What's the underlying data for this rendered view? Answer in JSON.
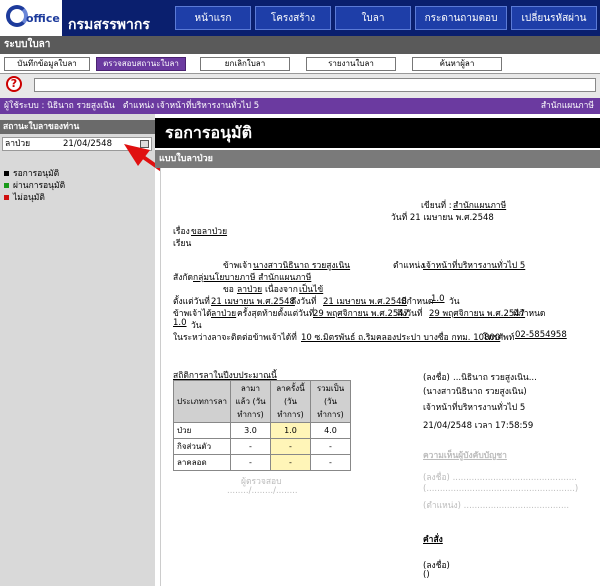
{
  "header": {
    "logo_text": "office",
    "org_name": "กรมสรรพากร",
    "nav": [
      {
        "label": "หน้าแรก"
      },
      {
        "label": "โครงสร้าง"
      },
      {
        "label": "ใบลา"
      },
      {
        "label": "กระดานถามตอบ"
      },
      {
        "label": "เปลี่ยนรหัสผ่าน"
      }
    ]
  },
  "system_title": "ระบบใบลา",
  "menu": [
    {
      "label": "บันทึกข้อมูลใบลา"
    },
    {
      "label": "ตรวจสอบสถานะใบลา"
    },
    {
      "label": "ยกเลิกใบลา"
    },
    {
      "label": "รายงานใบลา"
    },
    {
      "label": "ค้นหาผู้ลา"
    }
  ],
  "help": {
    "icon_char": "?"
  },
  "userbar": {
    "user": "ผู้ใช้ระบบ : นิธินาถ รวยสูงเนิน",
    "position": "ตำแหน่ง เจ้าหน้าที่บริหารงานทั่วไป 5",
    "dept": "สำนักแผนภาษี"
  },
  "left": {
    "title": "สถานะใบลาของท่าน",
    "row_type": "ลาป่วย",
    "row_date": "21/04/2548",
    "legend": [
      {
        "label": "รอการอนุมัติ",
        "color": "#000000"
      },
      {
        "label": "ผ่านการอนุมัติ",
        "color": "#1a9a1a"
      },
      {
        "label": "ไม่อนุมัติ",
        "color": "#d01010"
      }
    ]
  },
  "main": {
    "title": "รอการอนุมัติ",
    "form_name": "แบบใบลาป่วย",
    "written_at_label": "เขียนที่ :",
    "written_at": "สำนักแผนภาษี",
    "date_line": "วันที่ 21 เมษายน พ.ศ.2548",
    "subject_label": "เรื่อง",
    "subject": "ขอลาป่วย",
    "to": "เรียน",
    "i_am": "ข้าพเจ้า",
    "name": "นางสาวนิธินาถ รวยสูงเนิน",
    "position_label": "ตำแหน่ง",
    "position": "เจ้าหน้าที่บริหารงานทั่วไป 5",
    "affiliation_label": "สังกัด",
    "affiliation": "กลุ่มนโยบายภาษี สำนักแผนภาษี",
    "request_label": "ขอ",
    "request": "ลาป่วย",
    "reason_label": "เนื่องจาก",
    "reason": "เป็นไข้",
    "from_label": "ตั้งแต่วันที่",
    "from_date": "21 เมษายน พ.ศ.2548",
    "to_label": "ถึงวันที่",
    "to_date": "21 เมษายน พ.ศ.2548",
    "days_label": "มีกำหนด",
    "days": "1.0",
    "days_unit": "วัน",
    "last_label": "ข้าพเจ้าได้",
    "last_type": "ลาป่วย",
    "last_mid": "ครั้งสุดท้ายตั้งแต่วันที่",
    "last_from": "29 พฤศจิกายน พ.ศ.2547",
    "last_to_label": "ถึงวันที่",
    "last_to": "29 พฤศจิกายน พ.ศ.2547",
    "last_days_label": "มีกำหนด",
    "last_days": "1.0",
    "last_days_unit": "วัน",
    "contact_label": "ในระหว่างลาจะติดต่อข้าพเจ้าได้ที่",
    "contact": "10 ซ.มิตรพันธ์ ถ.ริมคลองประปา บางซื่อ กทม. 10800",
    "phone_label": "โทรศัพท์",
    "phone": "02-5854958",
    "stats_title": "สถิติการลาในปีงบประมาณนี้",
    "stats_headers": [
      "ประเภทการลา",
      "ลามาแล้ว (วันทำการ)",
      "ลาครั้งนี้ (วันทำการ)",
      "รวมเป็น (วันทำการ)"
    ],
    "stats_rows": [
      [
        "ป่วย",
        "3.0",
        "1.0",
        "4.0"
      ],
      [
        "กิจส่วนตัว",
        "-",
        "-",
        "-"
      ],
      [
        "ลาคลอด",
        "-",
        "-",
        "-"
      ]
    ],
    "sign_label": "(ลงชื่อ)",
    "sign_name_dots": "...นิธินาถ รวยสูงเนิน...",
    "sign_full": "(นางสาวนิธินาถ รวยสูงเนิน)",
    "sign_position": "เจ้าหน้าที่บริหารงานทั่วไป 5",
    "sign_datetime": "21/04/2548 เวลา 17:58:59",
    "checker": "ผู้ตรวจสอบ",
    "checker_date": "......../......../........",
    "opinion_title": "ความเห็นผู้บังคับบัญชา",
    "opinion_sign": "(ลงชื่อ) ..............................................",
    "opinion_paren": "(.......................................................)",
    "opinion_pos": "(ตำแหน่ง) .......................................",
    "order_title": "คำสั่ง",
    "order_sign": "(ลงชื่อ)",
    "order_paren": "()"
  }
}
